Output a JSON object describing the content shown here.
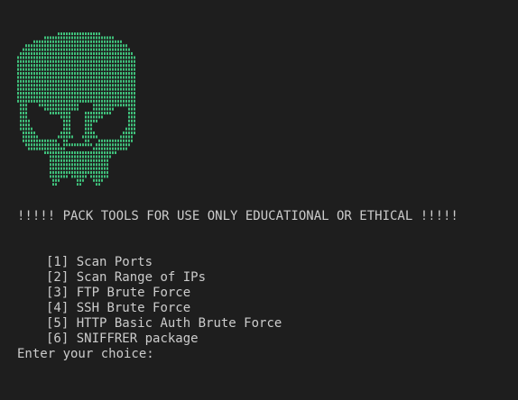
{
  "colors": {
    "background": "#1e1e1e",
    "text": "#cccccc",
    "skull": "#3fbf7a"
  },
  "banner": {
    "icon": "skull-icon",
    "skull_rows": [
      [
        [
          15,
          30
        ]
      ],
      [
        [
          10,
          35
        ]
      ],
      [
        [
          6,
          38
        ]
      ],
      [
        [
          3,
          40
        ],
        [
          11,
          13
        ]
      ],
      [
        [
          2,
          41
        ]
      ],
      [
        [
          1,
          42
        ],
        [
          8,
          10
        ]
      ],
      [
        [
          0,
          43
        ],
        [
          7,
          9
        ]
      ],
      [
        [
          0,
          43
        ],
        [
          6,
          7
        ]
      ],
      [
        [
          0,
          43
        ],
        [
          6,
          7
        ]
      ],
      [
        [
          0,
          43
        ]
      ],
      [
        [
          0,
          43
        ]
      ],
      [
        [
          0,
          43
        ]
      ],
      [
        [
          0,
          43
        ]
      ],
      [
        [
          0,
          43
        ]
      ],
      [
        [
          0,
          43
        ]
      ],
      [
        [
          0,
          43
        ]
      ],
      [
        [
          0,
          43
        ]
      ],
      [
        [
          0,
          43
        ]
      ],
      [
        [
          1,
          3
        ],
        [
          8,
          22
        ],
        [
          28,
          43
        ]
      ],
      [
        [
          1,
          3
        ],
        [
          10,
          22
        ],
        [
          28,
          35
        ],
        [
          41,
          43
        ]
      ],
      [
        [
          1,
          3
        ],
        [
          12,
          19
        ],
        [
          25,
          34
        ],
        [
          41,
          43
        ]
      ],
      [
        [
          1,
          3
        ],
        [
          16,
          19
        ],
        [
          25,
          31
        ],
        [
          41,
          43
        ]
      ],
      [
        [
          1,
          4
        ],
        [
          17,
          19
        ],
        [
          25,
          29
        ],
        [
          41,
          43
        ]
      ],
      [
        [
          1,
          4
        ],
        [
          17,
          19
        ],
        [
          25,
          27
        ],
        [
          41,
          43
        ]
      ],
      [
        [
          1,
          5
        ],
        [
          17,
          19
        ],
        [
          25,
          27
        ],
        [
          40,
          43
        ]
      ],
      [
        [
          2,
          6
        ],
        [
          16,
          19
        ],
        [
          25,
          28
        ],
        [
          39,
          43
        ]
      ],
      [
        [
          2,
          7
        ],
        [
          15,
          20
        ],
        [
          24,
          29
        ],
        [
          38,
          42
        ]
      ],
      [
        [
          2,
          14
        ],
        [
          17,
          18
        ],
        [
          25,
          26
        ],
        [
          30,
          42
        ]
      ],
      [
        [
          3,
          15
        ],
        [
          17,
          27
        ],
        [
          29,
          41
        ]
      ],
      [
        [
          4,
          17
        ],
        [
          28,
          40
        ]
      ],
      [
        [
          10,
          36
        ]
      ],
      [
        [
          12,
          34
        ]
      ],
      [
        [
          12,
          33
        ]
      ],
      [
        [
          12,
          33
        ]
      ],
      [
        [
          12,
          33
        ]
      ],
      [
        [
          12,
          33
        ]
      ],
      [
        [
          12,
          18
        ],
        [
          20,
          25
        ],
        [
          27,
          33
        ]
      ],
      [
        [
          13,
          15
        ],
        [
          22,
          24
        ],
        [
          28,
          31
        ]
      ],
      [
        [
          13,
          14
        ],
        [
          22,
          23
        ],
        [
          29,
          30
        ]
      ]
    ]
  },
  "warning_text": "!!!!! PACK TOOLS FOR USE ONLY EDUCATIONAL OR ETHICAL !!!!!",
  "menu": {
    "items": [
      {
        "key": "[1]",
        "label": "Scan Ports"
      },
      {
        "key": "[2]",
        "label": "Scan Range of IPs"
      },
      {
        "key": "[3]",
        "label": "FTP Brute Force"
      },
      {
        "key": "[4]",
        "label": "SSH Brute Force"
      },
      {
        "key": "[5]",
        "label": "HTTP Basic Auth Brute Force"
      },
      {
        "key": "[6]",
        "label": "SNIFFRER package"
      }
    ]
  },
  "prompt": {
    "label": "Enter your choice:",
    "value": ""
  }
}
